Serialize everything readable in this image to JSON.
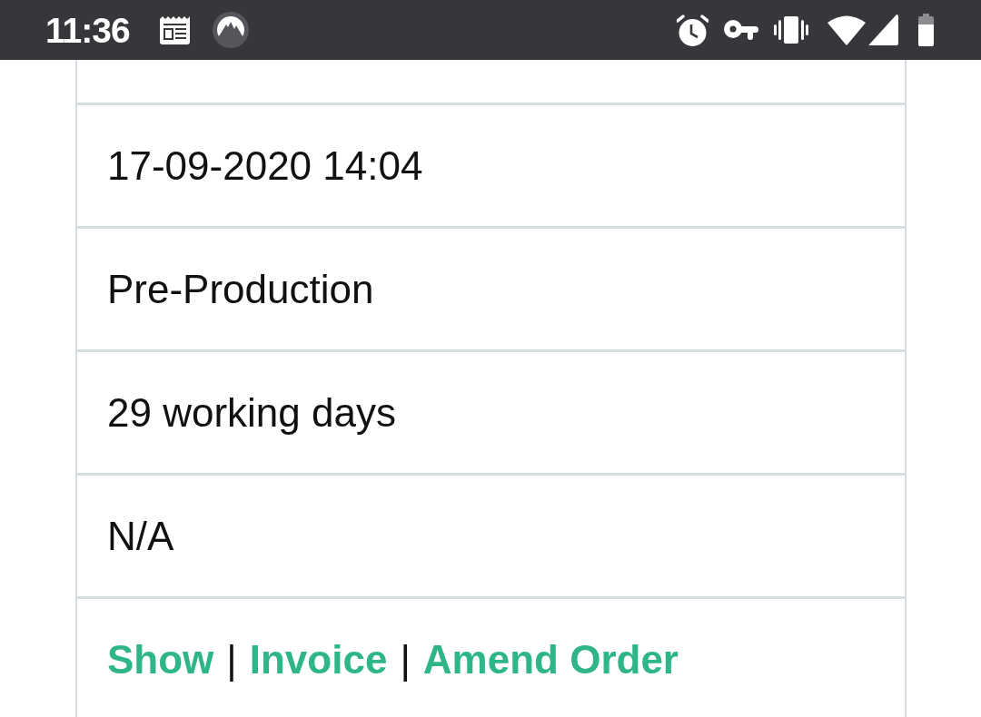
{
  "status_bar": {
    "time": "11:36"
  },
  "table": {
    "rows": [
      {
        "kind": "blank"
      },
      {
        "kind": "text",
        "text": "17-09-2020 14:04"
      },
      {
        "kind": "text",
        "text": "Pre-Production"
      },
      {
        "kind": "text",
        "text": "29 working days"
      },
      {
        "kind": "text",
        "text": "N/A"
      },
      {
        "kind": "actions",
        "items": [
          {
            "kind": "link",
            "text": "Show"
          },
          {
            "kind": "separator",
            "text": "|"
          },
          {
            "kind": "link",
            "text": "Invoice"
          },
          {
            "kind": "separator",
            "text": "|"
          },
          {
            "kind": "link",
            "text": "Amend Order"
          }
        ]
      }
    ]
  }
}
